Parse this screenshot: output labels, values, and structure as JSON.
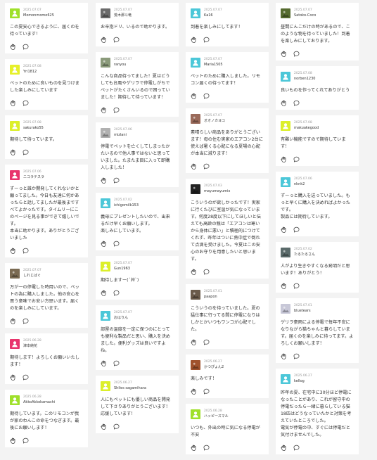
{
  "columns": [
    [
      {
        "date": "2025.07.07",
        "name": "Momonmomo625",
        "text": "この夏安心できるように、届くのを待っています！",
        "avatar": "#9fe02b",
        "icon": "user-icon"
      },
      {
        "date": "2025.07.08",
        "name": "Yri1812",
        "text": "ペットのために良いものを見つけました楽しみにしています",
        "avatar": "#e6f02a",
        "icon": "user-icon"
      },
      {
        "date": "2025.07.08",
        "name": "sakurako55",
        "text": "期待して待っています。",
        "avatar": "#dcef2a",
        "icon": "user-icon"
      },
      {
        "date": "2025.07.06",
        "name": "ニコラテスラ",
        "text": "ずーっと誰か開発してくれないかと願ってました。今日も友達に何かあったらと話してましたが最後まですべてよかったです。タイムリーにこのページを見る事ができて嬉しいです。\n本当に助かります。ありがとうございました",
        "avatar": "#e8356d",
        "icon": "user-icon"
      },
      {
        "date": "2025.07.07",
        "name": "しれじばぐ",
        "text": "万が一の停電した時用いので、ペットの為に購入しました。他の安心を買う意味でお安い方思います。届くのを楽しみにしています。",
        "avatar": "#7a6a52",
        "icon": "photo-icon"
      },
      {
        "date": "2025.06.28",
        "name": "津本純花",
        "text": "期待します！よろしくお願いいたします！",
        "avatar": "#e8356d",
        "icon": "user-icon"
      },
      {
        "date": "2025.06.28",
        "name": "AkkoAkkokamachi",
        "text": "期待しています。このリモコンが我が家のわんこの命をつなぎます。最後にお願いします！",
        "avatar": "#9fe02b",
        "icon": "user-icon"
      }
    ],
    [
      {
        "date": "2025.07.07",
        "name": "荒木那斗竜",
        "text": "お辛抱ドリ、いるので助かります。",
        "avatar": "#6a6a6a",
        "icon": "photo-icon"
      },
      {
        "date": "2025.07.07",
        "name": "ranyou",
        "text": "こんな商品待ってました！夏はどうしても台風やゲリラで停電しがちでペットがたくさんいるので困っていました！期待して待っています！",
        "avatar": "#8a9a7a",
        "icon": "photo-icon"
      },
      {
        "date": "2025.07.06",
        "name": "mizlani",
        "text": "停電でペットを亡くしてしまったかたいるので他人事ではないと思っていました。たまたま目に入って即購入しました！",
        "avatar": "#b0b0b0",
        "icon": "photo-icon"
      },
      {
        "date": "2025.07.02",
        "name": "ichigomilk153",
        "text": "義母にプレゼントしたいので、出来るだけ早くお願いします。\n楽しみにしています。",
        "avatar": "#4cc7d8",
        "icon": "user-icon"
      },
      {
        "date": "2025.07.07",
        "name": "Gun1963",
        "text": "期待しますー(´艸`)",
        "avatar": "#dcef2a",
        "icon": "user-icon"
      },
      {
        "date": "2025.07.07",
        "name": "おはりん",
        "text": "部屋の温度を一定に保つのにとっても便利な製品だと思い、購入を決めました。便利グッズは良いですよね。",
        "avatar": "#4cc7d8",
        "icon": "user-icon"
      },
      {
        "date": "2025.06.27",
        "name": "Shiles sagamihara",
        "text": "人にもペットにも優しい商品を開発して下さりありがとうございます！応援しています！",
        "avatar": "#dcef2a",
        "icon": "user-icon"
      }
    ],
    [
      {
        "date": "2025.07.07",
        "name": "Ka16",
        "text": "到着を楽しみにしてます！",
        "avatar": "#4cc7d8",
        "icon": "user-icon"
      },
      {
        "date": "2025.07.07",
        "name": "Maria1505",
        "text": "ペットのために購入しました。リモコン届くの待ってます！",
        "avatar": "#4cc7d8",
        "icon": "user-icon"
      },
      {
        "date": "2025.07.07",
        "name": "オオノカヨコ",
        "text": "素晴らしい商品をありがとうございます！母の住む実家のエアコン2台に使えば暑くる心配になる夏場の心配が本当に減ります！",
        "avatar": "#9a6a5a",
        "icon": "photo-icon"
      },
      {
        "date": "2025.07.03",
        "name": "mayumayumix",
        "text": "こういうのが欲しかったです！実家に行くたびに室温が気になっています。何度28度以下にしてほしいと伝えても高齢の親は「エアコンは寒いから身体に悪い」と積極的につけてくれず、昨年はついに熱中症で倒れて点滴を受けました。今夏はこの安心のお守りを用意したいと思います。",
        "avatar": "#222222",
        "icon": "photo-icon"
      },
      {
        "date": "2025.07.01",
        "name": "paapon",
        "text": "こういうのを待っていました。夏の猛仕事に行ってる間に停電になりはしかとかいつもワンコが心配でした。",
        "avatar": "#6a5a4a",
        "icon": "photo-icon"
      },
      {
        "date": "2025.06.27",
        "name": "かつぴょん2",
        "text": "楽しみです！",
        "avatar": "#a0522d",
        "icon": "photo-icon"
      },
      {
        "date": "2025.06.28",
        "name": "ハッピースマル",
        "text": "いつも、外出の時に気になる停電が不安",
        "avatar": "#9fe02b",
        "icon": "user-icon"
      }
    ],
    [
      {
        "date": "2025.07.07",
        "name": "Satoko-Coco",
        "text": "昼間にんこだけの時があるので、このような物を待っていました！到着を楽しみにしております。",
        "avatar": "#556b2f",
        "icon": "photo-icon"
      },
      {
        "date": "2025.07.08",
        "name": "norben1230",
        "text": "良いものを作ってくれてありがとう",
        "avatar": "#4cc7d8",
        "icon": "user-icon"
      },
      {
        "date": "2025.07.08",
        "name": "makuakegood",
        "text": "有難い機能ですので期待しています！",
        "avatar": "#dcef2a",
        "icon": "user-icon"
      },
      {
        "date": "2025.07.06",
        "name": "nknk2",
        "text": "ずーっと購入を送っていました。もっと早くに購入を決めればよかったです。\n製品には期待しています。",
        "avatar": "#4cc7d8",
        "icon": "user-icon"
      },
      {
        "date": "2025.07.02",
        "name": "たるたるさん",
        "text": "人がより生きやすくなる発明だと思います！ありがとう！",
        "avatar": "#5a6a6a",
        "icon": "photo-icon"
      },
      {
        "date": "2025.07.01",
        "name": "bluetears",
        "text": "ゲリラ豪雨による停電で毎年不安になりながら猫ちゃんと暮らしています。届くのを楽しみに待ってます。よろしくお願いします！",
        "avatar": "#c8c8d8",
        "icon": "photo-icon"
      },
      {
        "date": "2025.06.27",
        "name": "kellog",
        "text": "昨年の夏、在宅中に30分ほど停電になったことがあり、これが留守中の停電だったら一緒に暮らしている猫18匹はどうなっていたかと対策を考えていたところでした。\n電気が停電の中、すぐには停電だと気付けませんでした。",
        "avatar": "#4cc7d8",
        "icon": "user-icon"
      }
    ]
  ]
}
